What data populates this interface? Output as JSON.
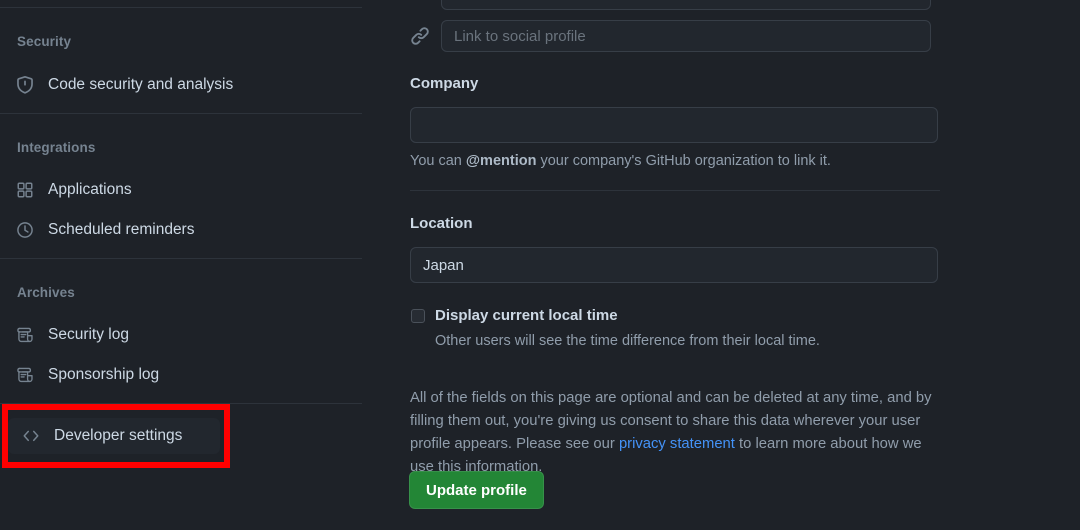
{
  "theme": {
    "page_bg": "#1e2228",
    "panel_bg": "#22272e",
    "border": "#373e47",
    "divider": "#2d333b",
    "text": "#cdd9e5",
    "muted": "#768390",
    "link": "#4493f8",
    "button_green": "#238636",
    "highlight_red": "#ff0000"
  },
  "sidebar": {
    "groups": [
      {
        "title": "Security",
        "items": [
          {
            "label": "Code security and analysis",
            "icon": "shield-icon"
          }
        ]
      },
      {
        "title": "Integrations",
        "items": [
          {
            "label": "Applications",
            "icon": "apps-grid-icon"
          },
          {
            "label": "Scheduled reminders",
            "icon": "clock-icon"
          }
        ]
      },
      {
        "title": "Archives",
        "items": [
          {
            "label": "Security log",
            "icon": "log-scroll-icon"
          },
          {
            "label": "Sponsorship log",
            "icon": "log-scroll-icon"
          }
        ]
      }
    ],
    "footer_item": {
      "label": "Developer settings",
      "icon": "code-brackets-icon"
    }
  },
  "main": {
    "social_profile": {
      "icon": "link-icon",
      "placeholder": "Link to social profile",
      "value": ""
    },
    "company": {
      "label": "Company",
      "value": "",
      "placeholder": "",
      "help_prefix": "You can ",
      "help_mention": "@mention",
      "help_suffix": " your company's GitHub organization to link it."
    },
    "location": {
      "label": "Location",
      "value": "Japan",
      "placeholder": ""
    },
    "local_time": {
      "label": "Display current local time",
      "sublabel": "Other users will see the time difference from their local time.",
      "checked": false
    },
    "legal": {
      "part1": "All of the fields on this page are optional and can be deleted at any time, and by filling them out, you're giving us consent to share this data wherever your user profile appears. Please see our ",
      "link": "privacy statement",
      "part2": " to learn more about how we use this information."
    },
    "update_button": "Update profile"
  }
}
